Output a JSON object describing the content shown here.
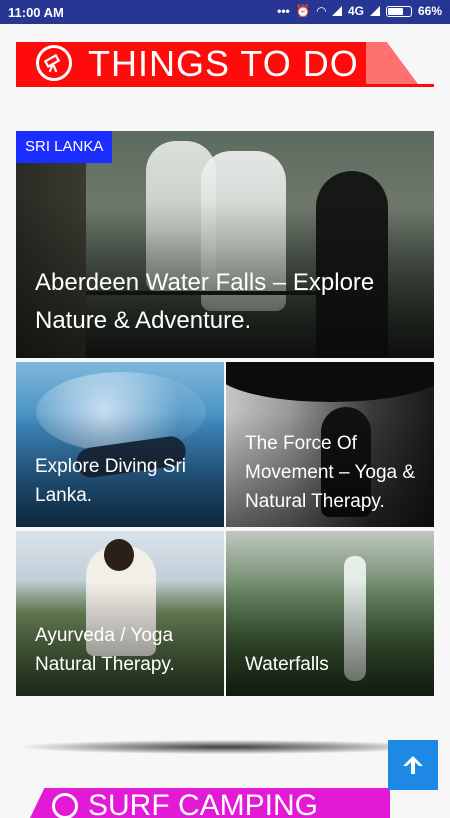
{
  "status_bar": {
    "time": "11:00 AM",
    "network": "4G",
    "battery": "66%"
  },
  "section": {
    "title": "THINGS TO DO",
    "icon": "telescope-icon",
    "accent": "#ff0b0b"
  },
  "featured": {
    "tag": "SRI LANKA",
    "title": "Aberdeen Water Falls – Explore Nature & Adventure."
  },
  "tiles": [
    {
      "title": "Explore Diving Sri Lanka."
    },
    {
      "title": "The Force Of Movement – Yoga & Natural Therapy."
    },
    {
      "title": "Ayurveda / Yoga Natural Therapy."
    },
    {
      "title": "Waterfalls"
    }
  ],
  "next_section": {
    "title": "SURF CAMPING",
    "accent": "#e21ad6"
  },
  "scroll_top": {
    "icon": "arrow-up-icon",
    "accent": "#1e88e5"
  }
}
